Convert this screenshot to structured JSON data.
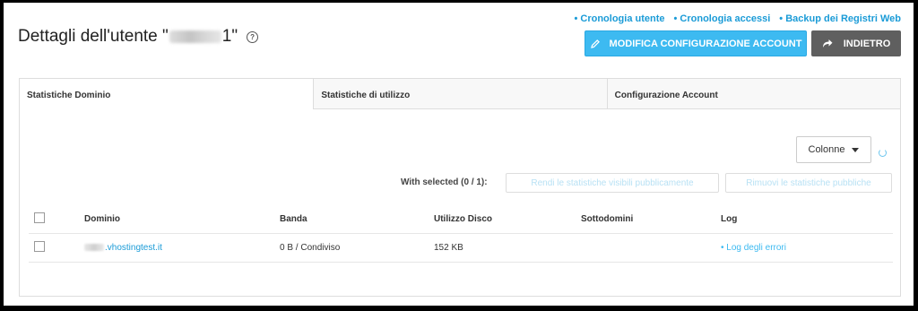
{
  "header": {
    "title_prefix": "Dettagli dell'utente \"",
    "title_suffix": "1\""
  },
  "top_links": [
    "Cronologia utente",
    "Cronologia accessi",
    "Backup dei Registri Web"
  ],
  "buttons": {
    "edit_config": "MODIFICA CONFIGURAZIONE ACCOUNT",
    "back": "INDIETRO"
  },
  "tabs": [
    {
      "label": "Statistiche Dominio",
      "active": true
    },
    {
      "label": "Statistiche di utilizzo",
      "active": false
    },
    {
      "label": "Configurazione Account",
      "active": false
    }
  ],
  "toolbar": {
    "columns_label": "Colonne",
    "with_selected": "With selected (0 / 1):",
    "make_public": "Rendi le statistiche visibili pubblicamente",
    "remove_public": "Rimuovi le statistiche pubbliche"
  },
  "table": {
    "columns": [
      "Dominio",
      "Banda",
      "Utilizzo Disco",
      "Sottodomini",
      "Log"
    ],
    "rows": [
      {
        "domain": ".vhostingtest.it",
        "bandwidth": "0 B / Condiviso",
        "disk": "152 KB",
        "subdomains": "",
        "log": "Log degli errori"
      }
    ]
  },
  "icons": {
    "help": "question-circle-icon",
    "edit": "pencil-icon",
    "back": "share-arrow-icon",
    "refresh": "refresh-icon"
  },
  "colors": {
    "accent": "#3dbaf1",
    "link": "#1a9bd7",
    "back_button": "#5f5f5f"
  }
}
